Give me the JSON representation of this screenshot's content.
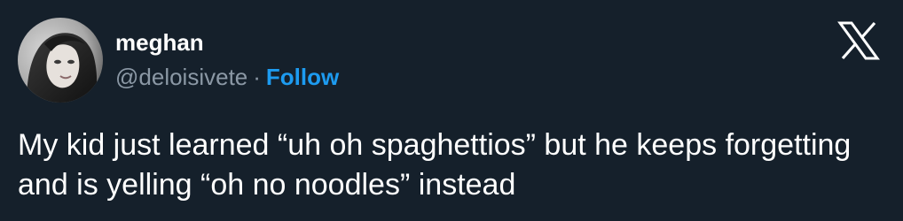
{
  "colors": {
    "background": "#15202b",
    "text": "#ffffff",
    "muted": "#8b98a5",
    "accent": "#1d9bf0"
  },
  "author": {
    "display_name": "meghan",
    "handle": "@deloisivete",
    "separator": "·",
    "follow_label": "Follow"
  },
  "icons": {
    "avatar": "avatar-photo",
    "brand": "x-logo-icon"
  },
  "tweet": {
    "text": "My kid just learned “uh oh spaghettios” but he keeps forgetting and is yelling “oh no noodles” instead"
  }
}
